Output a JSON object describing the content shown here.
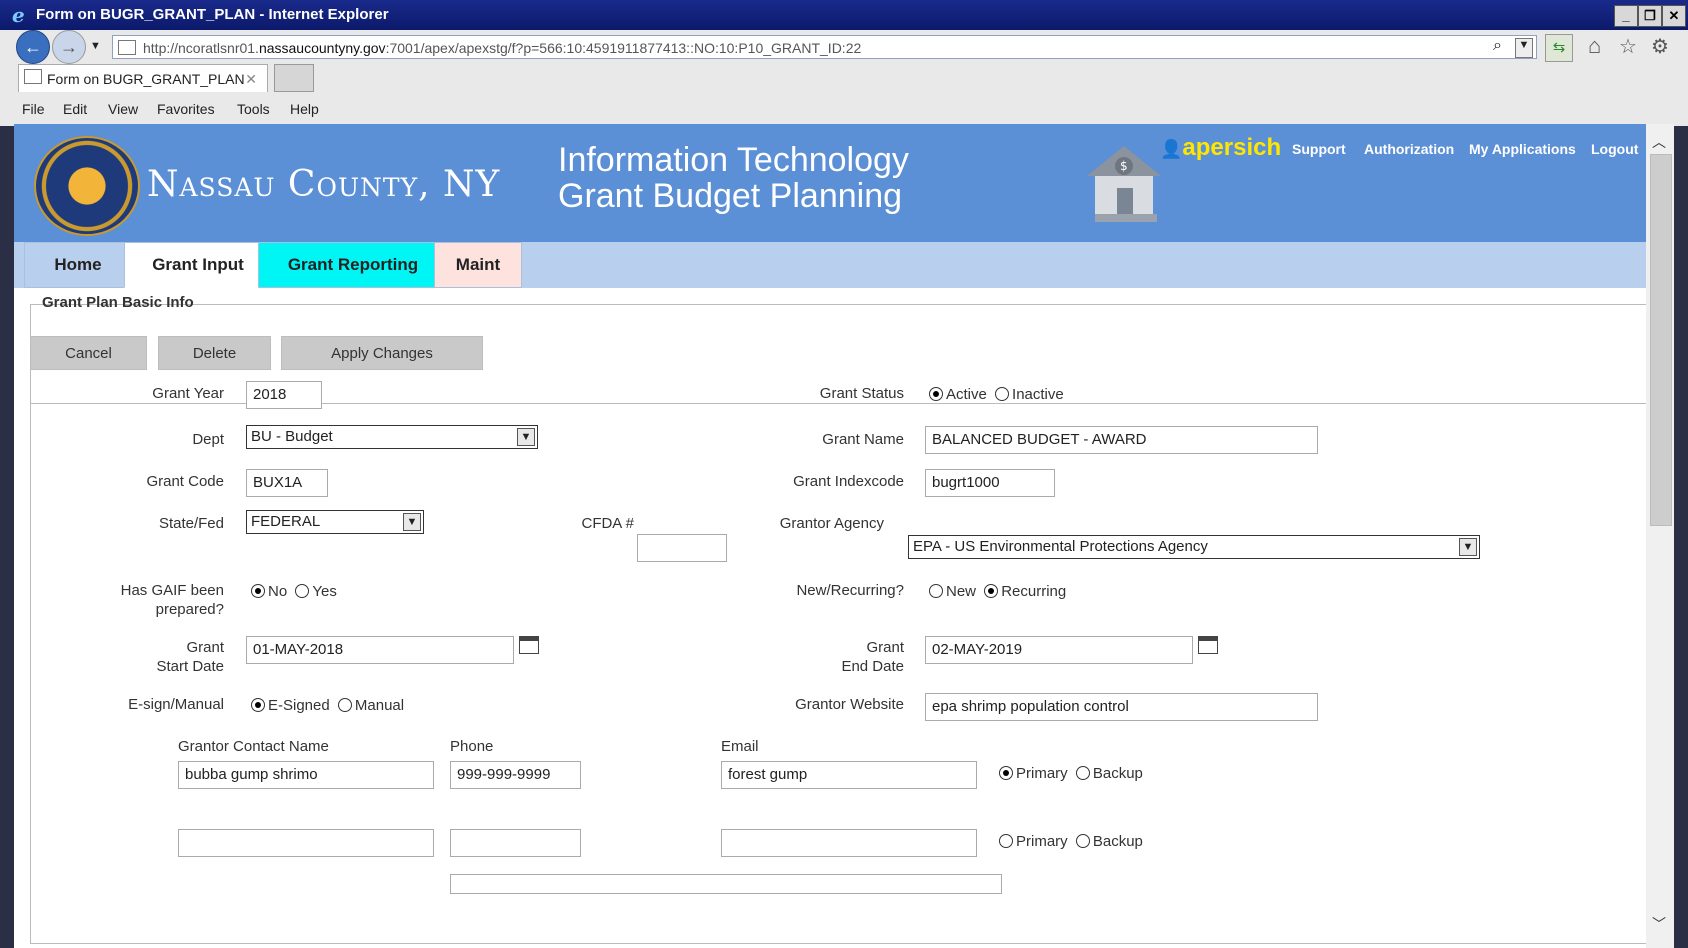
{
  "window": {
    "title": "Form on BUGR_GRANT_PLAN - Internet Explorer",
    "url_prefix": "http://ncoratlsnr01.",
    "url_domain": "nassaucountyny.gov",
    "url_rest": ":7001/apex/apexstg/f?p=566:10:4591911877413::NO:10:P10_GRANT_ID:22",
    "tab_label": "Form on BUGR_GRANT_PLAN",
    "menu": [
      "File",
      "Edit",
      "View",
      "Favorites",
      "Tools",
      "Help"
    ]
  },
  "header": {
    "county": "Nassau County, NY",
    "app_line1": "Information Technology",
    "app_line2": "Grant Budget Planning",
    "user": "apersich",
    "links": [
      "Support",
      "Authorization",
      "My Applications",
      "Logout"
    ]
  },
  "nav": {
    "tabs": [
      {
        "label": "Home",
        "color": "#b8d0ee"
      },
      {
        "label": "Grant Input",
        "color": "#ffffff"
      },
      {
        "label": "Grant Reporting",
        "color": "#00f5f5"
      },
      {
        "label": "Maint",
        "color": "#fde2de"
      }
    ]
  },
  "region": {
    "title": "Grant Plan Basic Info",
    "buttons": [
      "Cancel",
      "Delete",
      "Apply Changes"
    ]
  },
  "form": {
    "grant_year": {
      "label": "Grant Year",
      "value": "2018"
    },
    "grant_status": {
      "label": "Grant Status",
      "options": [
        "Active",
        "Inactive"
      ],
      "selected": "Active"
    },
    "dept": {
      "label": "Dept",
      "value": "BU - Budget"
    },
    "grant_name": {
      "label": "Grant Name",
      "value": "BALANCED BUDGET - AWARD"
    },
    "grant_code": {
      "label": "Grant Code",
      "value": "BUX1A"
    },
    "grant_indexcode": {
      "label": "Grant Indexcode",
      "value": "bugrt1000"
    },
    "state_fed": {
      "label": "State/Fed",
      "value": "FEDERAL"
    },
    "cfda": {
      "label": "CFDA #",
      "value": ""
    },
    "grantor_agency": {
      "label": "Grantor Agency",
      "value": "EPA - US Environmental Protections Agency"
    },
    "gaif": {
      "label_line1": "Has GAIF been",
      "label_line2": "prepared?",
      "options": [
        "No",
        "Yes"
      ],
      "selected": "No"
    },
    "new_recurring": {
      "label": "New/Recurring?",
      "options": [
        "New",
        "Recurring"
      ],
      "selected": "Recurring"
    },
    "start_date": {
      "label_line1": "Grant",
      "label_line2": "Start Date",
      "value": "01-MAY-2018"
    },
    "end_date": {
      "label_line1": "Grant",
      "label_line2": "End Date",
      "value": "02-MAY-2019"
    },
    "esign": {
      "label": "E-sign/Manual",
      "options": [
        "E-Signed",
        "Manual"
      ],
      "selected": "E-Signed"
    },
    "grantor_website": {
      "label": "Grantor Website",
      "value": "epa shrimp population control"
    },
    "contacts_headers": {
      "name": "Grantor Contact Name",
      "phone": "Phone",
      "email": "Email"
    },
    "contacts": [
      {
        "name": "bubba gump shrimo",
        "phone": "999-999-9999",
        "email": "forest gump",
        "options": [
          "Primary",
          "Backup"
        ],
        "selected": "Primary"
      },
      {
        "name": "",
        "phone": "",
        "email": "",
        "options": [
          "Primary",
          "Backup"
        ],
        "selected": ""
      }
    ]
  }
}
